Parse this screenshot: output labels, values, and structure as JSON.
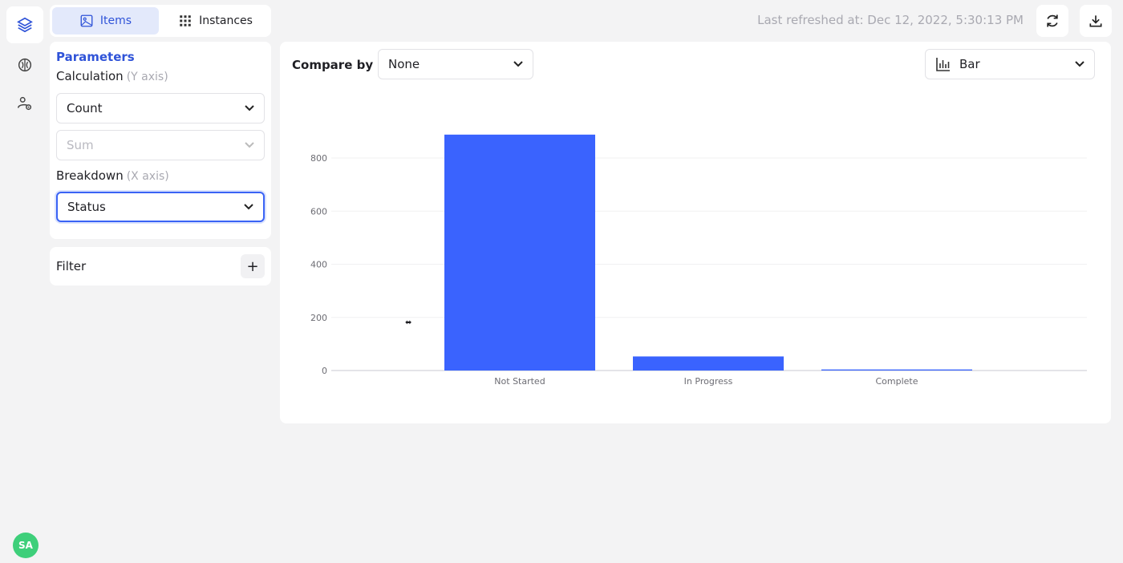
{
  "nav": {
    "items": [
      {
        "icon": "layers-icon",
        "active": true
      },
      {
        "icon": "brain-icon",
        "active": false
      },
      {
        "icon": "settings-users-icon",
        "active": false
      }
    ],
    "avatar_initials": "SA",
    "avatar_color": "#3ecf7a"
  },
  "tabs": [
    {
      "label": "Items",
      "icon": "image-icon",
      "active": true
    },
    {
      "label": "Instances",
      "icon": "grid-icon",
      "active": false
    }
  ],
  "header": {
    "last_refreshed": "Last refreshed at: Dec 12, 2022, 5:30:13 PM",
    "refresh_icon": "refresh-icon",
    "download_icon": "download-icon"
  },
  "parameters": {
    "title": "Parameters",
    "calculation_label": "Calculation",
    "calculation_hint": "(Y axis)",
    "calculation_value": "Count",
    "sum_placeholder": "Sum",
    "breakdown_label": "Breakdown",
    "breakdown_hint": "(X axis)",
    "breakdown_value": "Status"
  },
  "filter": {
    "label": "Filter",
    "add": "+"
  },
  "chart_controls": {
    "compare_label": "Compare by",
    "compare_value": "None",
    "chart_type": "Bar"
  },
  "colors": {
    "accent": "#2f53d8",
    "bar": "#3a63fe"
  },
  "chart_data": {
    "type": "bar",
    "categories": [
      "Not Started",
      "In Progress",
      "Complete"
    ],
    "values": [
      888,
      53,
      4
    ],
    "ylim": [
      0,
      900
    ],
    "yticks": [
      0,
      200,
      400,
      600,
      800
    ],
    "grid": true,
    "xlabel": "",
    "ylabel": ""
  }
}
